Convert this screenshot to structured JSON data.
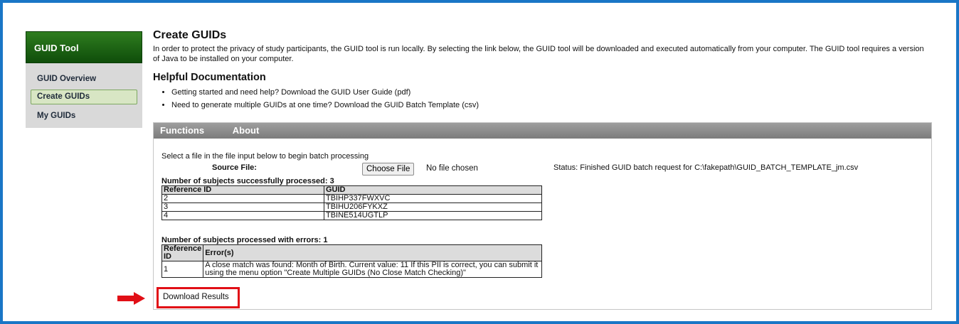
{
  "sidebar": {
    "title": "GUID Tool",
    "items": [
      {
        "label": "GUID Overview",
        "active": false
      },
      {
        "label": "Create GUIDs",
        "active": true
      },
      {
        "label": "My GUIDs",
        "active": false
      }
    ]
  },
  "main": {
    "title": "Create GUIDs",
    "intro": "In order to protect the privacy of study participants, the GUID tool is run locally. By selecting the link below, the GUID tool will be downloaded and executed automatically from your computer. The GUID tool requires a version of Java to be installed on your computer.",
    "doc_title": "Helpful Documentation",
    "doc_links": [
      "Getting started and need help? Download the GUID User Guide (pdf)",
      "Need to generate multiple GUIDs at one time? Download the GUID Batch Template (csv)"
    ]
  },
  "panel": {
    "tabs": [
      "Functions",
      "About"
    ],
    "instructions": "Select a file in the file input below to begin batch processing",
    "source_label": "Source File:",
    "choose_button": "Choose File",
    "no_file": "No file chosen",
    "status": "Status: Finished GUID batch request for C:\\fakepath\\GUID_BATCH_TEMPLATE_jm.csv",
    "success_title": "Number of subjects successfully processed: 3",
    "success_headers": [
      "Reference ID",
      "GUID"
    ],
    "success_rows": [
      [
        "2",
        "TBIHP337FWXVC"
      ],
      [
        "3",
        "TBIHU206FYKXZ"
      ],
      [
        "4",
        "TBINE514UGTLP"
      ]
    ],
    "error_title": "Number of subjects processed with errors: 1",
    "error_headers": [
      "Reference ID",
      "Error(s)"
    ],
    "error_rows": [
      [
        "1",
        "A close match was found: Month of Birth. Current value: 11 If this PII is correct, you can submit it using the menu option \"Create Multiple GUIDs (No Close Match Checking)\""
      ]
    ],
    "download_label": "Download Results"
  },
  "colors": {
    "frame_border": "#1a76c6",
    "sidebar_header": "#1f6a14",
    "highlight": "#e10f16"
  }
}
